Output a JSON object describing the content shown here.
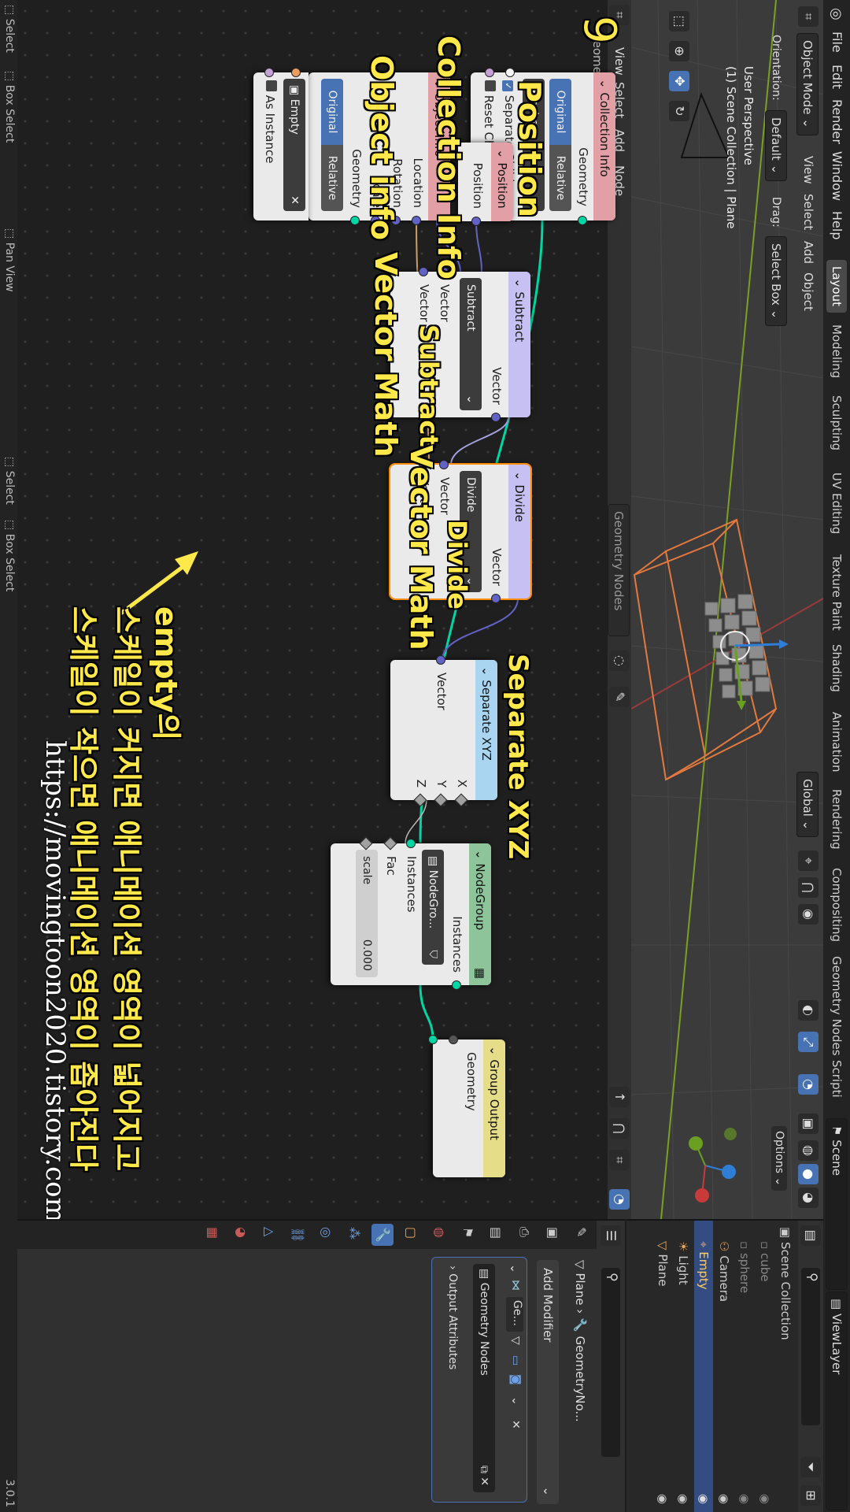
{
  "menu": [
    "File",
    "Edit",
    "Render",
    "Window",
    "Help"
  ],
  "workspaces": [
    "Layout",
    "Modeling",
    "Sculpting",
    "UV Editing",
    "Texture Paint",
    "Shading",
    "Animation",
    "Rendering",
    "Compositing",
    "Geometry Nodes",
    "Scripti"
  ],
  "scene_label": "Scene",
  "viewlayer_label": "ViewLayer",
  "viewport": {
    "mode": "Object Mode",
    "menus": [
      "View",
      "Select",
      "Add",
      "Object"
    ],
    "orientation_label": "Orientation:",
    "orientation_value": "Default",
    "drag_label": "Drag:",
    "drag_value": "Select Box",
    "transform_orientation": "Global",
    "info_line1": "User Perspective",
    "info_line2": "(1) Scene Collection | Plane",
    "options": "Options",
    "axes": [
      "X",
      "Y",
      "Z"
    ]
  },
  "node_editor": {
    "editor_title": "Geometry Nodes",
    "breadcrumb": "Geometry Nodes",
    "header_menus": [
      "View",
      "Select",
      "Add",
      "Node"
    ],
    "nodes": {
      "collection_info": {
        "title": "Collection Info",
        "output": "Geometry",
        "seg_original": "Original",
        "seg_relative": "Relative",
        "collection": "cube",
        "opt1": "Separate Childr...",
        "opt2": "Reset Children"
      },
      "position": {
        "title": "Position",
        "output": "Position"
      },
      "object_info": {
        "title": "Object Info",
        "outputs": [
          "Location",
          "Rotation",
          "Scale",
          "Geometry"
        ],
        "seg_original": "Original",
        "seg_relative": "Relative",
        "object": "Empty",
        "as_instance": "As Instance"
      },
      "subtract": {
        "title": "Subtract",
        "output": "Vector",
        "op": "Subtract",
        "in1": "Vector",
        "in2": "Vector"
      },
      "divide": {
        "title": "Divide",
        "output": "Vector",
        "op": "Divide",
        "in1": "Vector",
        "in2": "Vector"
      },
      "separate_xyz": {
        "title": "Separate XYZ",
        "input": "Vector",
        "outputs": [
          "X",
          "Y",
          "Z"
        ]
      },
      "nodegroup": {
        "title": "NodeGroup",
        "output": "Instances",
        "group": "NodeGro...",
        "in1": "Instances",
        "in2": "Fac",
        "field_label": "scale",
        "field_value": "0.000"
      },
      "group_output": {
        "title": "Group Output",
        "input": "Geometry"
      }
    }
  },
  "annotations": {
    "step_number": "9",
    "collection_info": "Collection Info",
    "position": "Position",
    "object_info": "Object info",
    "vector_math_1": "Vector Math",
    "subtract": "Subtract",
    "vector_math_2": "Vector Math",
    "divide": "Divide",
    "separate_xyz": "Separate XYZ",
    "korean_1": "empty의",
    "korean_2": "스케일이 커지면 애니메이션 영역이 넓어지고",
    "korean_3": "스케일이 작으면 애니메이션 영역이 좁아진다",
    "url": "https://movingtoon2020.tistory.com"
  },
  "status_bar": {
    "items": [
      "Select",
      "Box Select",
      "Pan View",
      "Select",
      "Box Select"
    ],
    "version": "3.0.1"
  },
  "outliner": {
    "root": "Scene Collection",
    "items": [
      "cube",
      "sphere",
      "Camera",
      "Empty",
      "Light",
      "Plane"
    ]
  },
  "properties": {
    "breadcrumb_obj": "Plane",
    "breadcrumb_mod": "GeometryNo...",
    "add_modifier": "Add Modifier",
    "modifier_name": "Ge...",
    "node_group": "Geometry Nodes",
    "output_attributes": "Output Attributes"
  },
  "colors": {
    "annotation": "#ffe94a",
    "geometry_socket": "#00d6a3",
    "vector_socket": "#6363c7",
    "selection_orange": "#ff8c00",
    "active_blue": "#4772b3"
  }
}
